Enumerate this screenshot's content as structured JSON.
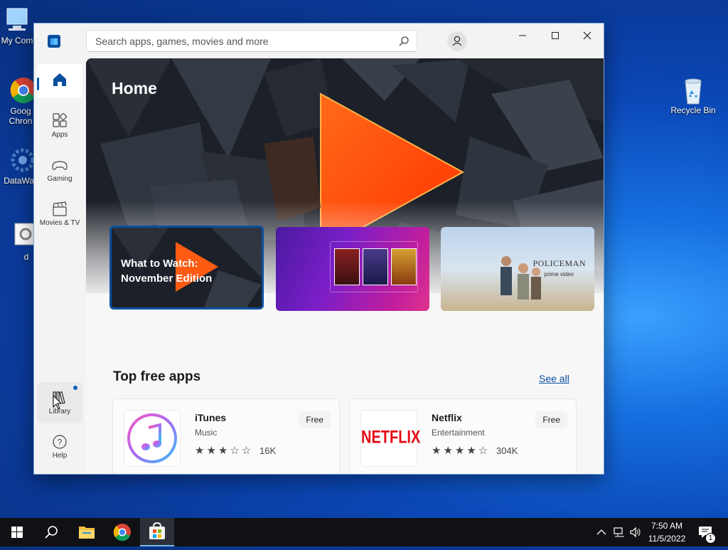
{
  "desktop": {
    "icons_left": [
      {
        "label": "My Com"
      },
      {
        "label": "Goog Chron"
      },
      {
        "label": "DataWag"
      },
      {
        "label": "d"
      }
    ],
    "recycle_bin": {
      "label": "Recycle Bin"
    }
  },
  "window": {
    "search": {
      "placeholder": "Search apps, games, movies and more",
      "value": ""
    },
    "nav": [
      {
        "label": "Home",
        "icon": "home-icon",
        "active": true
      },
      {
        "label": "Apps",
        "icon": "apps-icon"
      },
      {
        "label": "Gaming",
        "icon": "gamepad-icon"
      },
      {
        "label": "Movies & TV",
        "icon": "clapperboard-icon"
      },
      {
        "label": "Library",
        "icon": "library-icon",
        "badge": true
      },
      {
        "label": "Help",
        "icon": "help-icon"
      }
    ],
    "hero": {
      "title": "Home",
      "cards": [
        {
          "title": "What to Watch: November Edition"
        },
        {
          "title": ""
        },
        {
          "title": "POLICEMAN",
          "subtitle": "prime video"
        }
      ]
    },
    "section": {
      "title": "Top free apps",
      "see_all": "See all"
    },
    "apps": [
      {
        "name": "iTunes",
        "category": "Music",
        "price": "Free",
        "stars": 3,
        "rating_count": "16K"
      },
      {
        "name": "Netflix",
        "category": "Entertainment",
        "price": "Free",
        "stars": 4,
        "rating_count": "304K",
        "logo_text": "NETFLIX"
      }
    ]
  },
  "taskbar": {
    "time": "7:50 AM",
    "date": "11/5/2022",
    "notifications": "1"
  },
  "colors": {
    "accent": "#005fb8",
    "netflix_red": "#e50914",
    "store_blue": "#0a4f9e"
  }
}
